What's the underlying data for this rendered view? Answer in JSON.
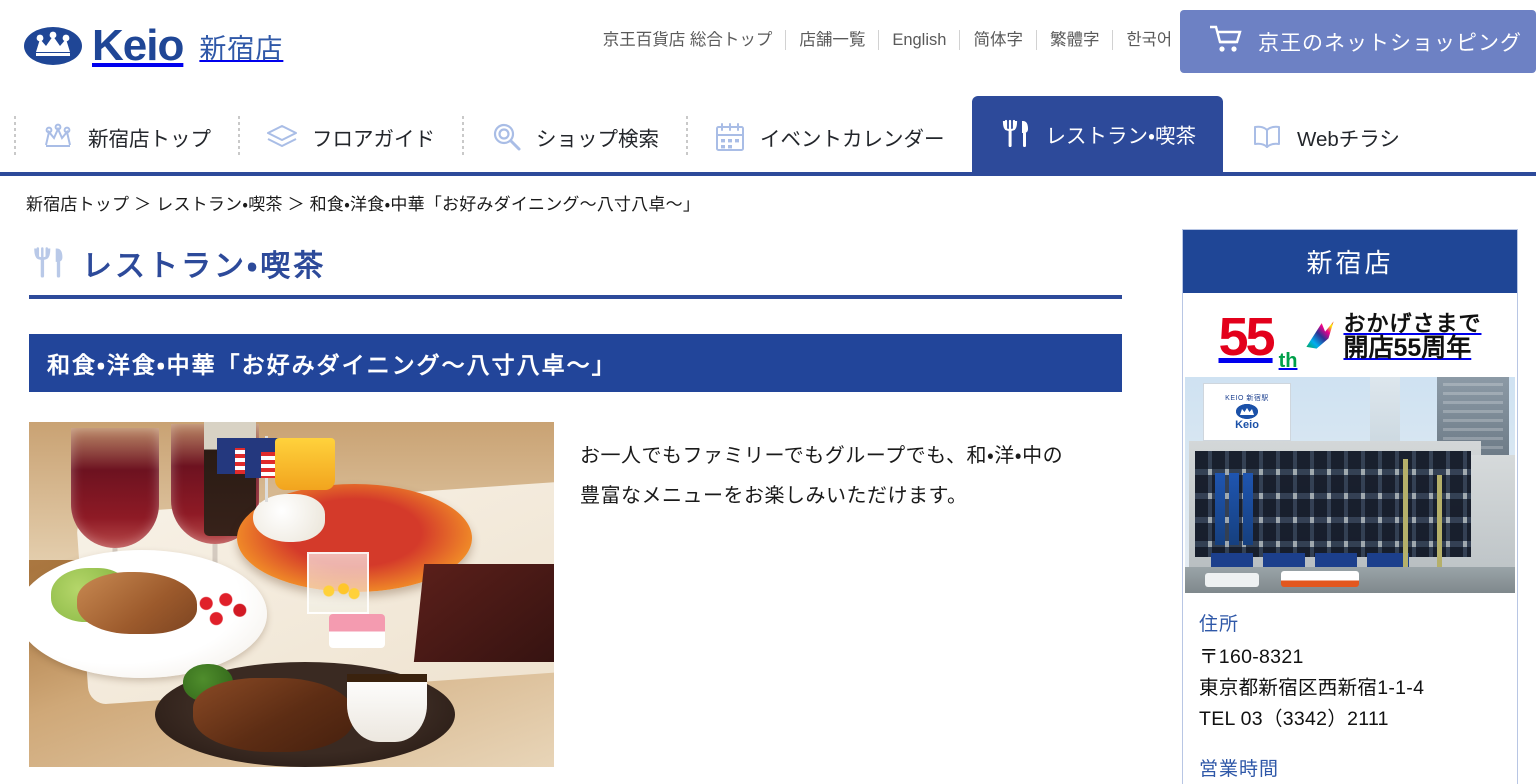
{
  "header": {
    "logo_text": "Keio",
    "logo_store": "新宿店",
    "logo_mark": "crown-logo-icon",
    "top_links": [
      {
        "label": "京王百貨店 総合トップ",
        "name": "link-keio-top"
      },
      {
        "label": "店舗一覧",
        "name": "link-store-list"
      },
      {
        "label": "English",
        "name": "link-english"
      },
      {
        "label": "简体字",
        "name": "link-simplified-chinese"
      },
      {
        "label": "繁體字",
        "name": "link-traditional-chinese"
      },
      {
        "label": "한국어",
        "name": "link-korean"
      }
    ],
    "cart": {
      "label": "京王のネットショッピング",
      "icon": "shopping-cart-icon",
      "bg": "#6d81c4"
    }
  },
  "mainnav": {
    "items": [
      {
        "label": "新宿店トップ",
        "icon": "crown-icon",
        "active": false
      },
      {
        "label": "フロアガイド",
        "icon": "layers-icon",
        "active": false
      },
      {
        "label": "ショップ検索",
        "icon": "search-icon",
        "active": false
      },
      {
        "label": "イベントカレンダー",
        "icon": "calendar-icon",
        "active": false
      },
      {
        "label": "レストラン・喫茶",
        "icon": "cutlery-icon",
        "active": true
      },
      {
        "label": "Webチラシ",
        "icon": "book-icon",
        "active": false
      }
    ],
    "active_color": "#2d4a9a"
  },
  "breadcrumb": {
    "text": "新宿店トップ ＞ レストラン・喫茶 ＞ 和食・洋食・中華「お好みダイニング～八寸八卓～」"
  },
  "main": {
    "page_title": "レストラン・喫茶",
    "page_title_icon": "cutlery-icon",
    "block_heading": "和食・洋食・中華「お好みダイニング～八寸八卓～」",
    "photo_alt": "restaurant-dishes-photo",
    "description_line1": "お一人でもファミリーでもグループでも、和・洋・中の",
    "description_line2": "豊富なメニューをお楽しみいただけます。",
    "accent_color": "#2d4a9a",
    "heading_bg": "#22459a"
  },
  "sidebar": {
    "store_name": "新宿店",
    "anniversary": {
      "number": "55",
      "suffix": "th",
      "line1": "おかげさまで",
      "line2": "開店55周年",
      "number_color": "#e3001b"
    },
    "building_photo": {
      "alt": "keio-shinjuku-store-building-photo",
      "sign_top": "KEIO 新宿駅",
      "sign_logo_text": "Keio"
    },
    "address_label": "住所",
    "address_lines": [
      "〒160-8321",
      "東京都新宿区西新宿1-1-4",
      "TEL 03（3342）2111"
    ],
    "hours_label": "営業時間"
  }
}
